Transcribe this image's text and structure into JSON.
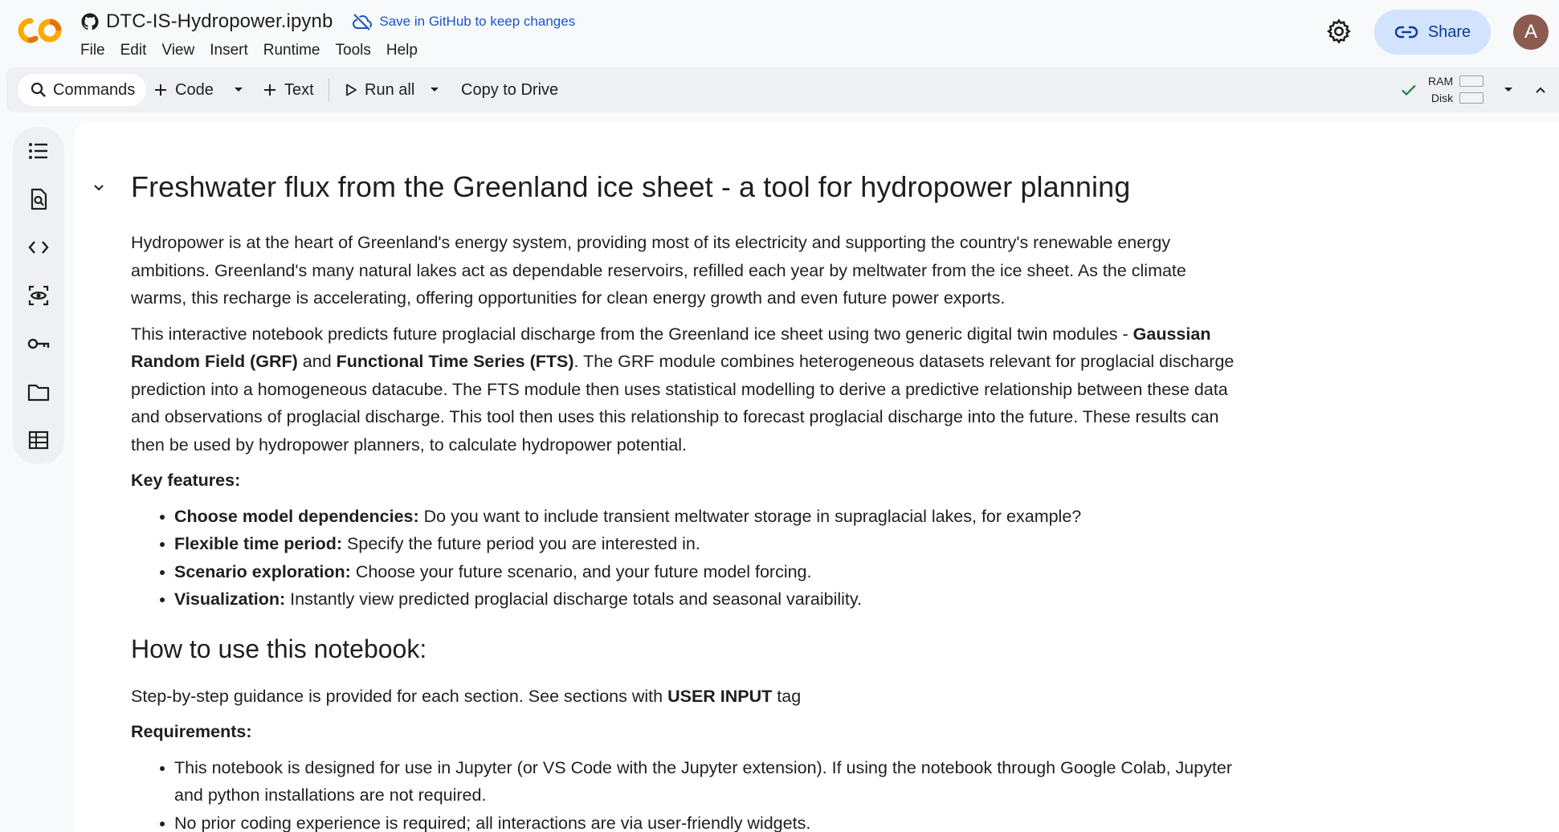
{
  "header": {
    "notebook_title": "DTC-IS-Hydropower.ipynb",
    "save_github_label": "Save in GitHub to keep changes",
    "menu": [
      "File",
      "Edit",
      "View",
      "Insert",
      "Runtime",
      "Tools",
      "Help"
    ],
    "share_label": "Share",
    "avatar_initial": "A"
  },
  "toolbar": {
    "commands_label": "Commands",
    "code_label": "Code",
    "text_label": "Text",
    "run_all_label": "Run all",
    "copy_to_drive_label": "Copy to Drive",
    "ram_label": "RAM",
    "disk_label": "Disk"
  },
  "colors": {
    "accent_blue": "#1a56c9",
    "share_bg": "#d3e3fd",
    "connected_green": "#188038",
    "logo_orange": "#f9ab00",
    "logo_dark_orange": "#e37400"
  },
  "sidebar_icons": [
    "table-of-contents-icon",
    "find-replace-icon",
    "code-snippets-icon",
    "variables-icon",
    "secrets-key-icon",
    "files-folder-icon",
    "data-table-icon"
  ],
  "notebook": {
    "title": "Freshwater flux from the Greenland ice sheet - a tool for hydropower planning",
    "intro": "Hydropower is at the heart of Greenland's energy system, providing most of its electricity and supporting the country's renewable energy ambitions. Greenland's many natural lakes act as dependable reservoirs, refilled each year by meltwater from the ice sheet. As the climate warms, this recharge is accelerating, offering opportunities for clean energy growth and even future power exports.",
    "p2_a": "This interactive notebook predicts future proglacial discharge from the Greenland ice sheet using two generic digital twin modules - ",
    "p2_grf": "Gaussian Random Field (GRF)",
    "p2_and": " and ",
    "p2_fts": "Functional Time Series (FTS)",
    "p2_b": ". The GRF module combines heterogeneous datasets relevant for proglacial discharge prediction into a homogeneous datacube. The FTS module then uses statistical modelling to derive a predictive relationship between these data and observations of proglacial discharge. This tool then uses this relationship to forecast proglacial discharge into the future. These results can then be used by hydropower planners, to calculate hydropower potential.",
    "key_features_heading": "Key features:",
    "features": [
      {
        "label": "Choose model dependencies:",
        "text": " Do you want to include transient meltwater storage in supraglacial lakes, for example?"
      },
      {
        "label": "Flexible time period:",
        "text": " Specify the future period you are interested in."
      },
      {
        "label": "Scenario exploration:",
        "text": " Choose your future scenario, and your future model forcing."
      },
      {
        "label": "Visualization:",
        "text": " Instantly view predicted proglacial discharge totals and seasonal varaibility."
      }
    ],
    "how_to_heading": "How to use this notebook:",
    "guidance_a": "Step-by-step guidance is provided for each section. See sections with ",
    "guidance_bold": "USER INPUT",
    "guidance_b": " tag",
    "requirements_heading": "Requirements:",
    "requirements": [
      "This notebook is designed for use in Jupyter (or VS Code with the Jupyter extension). If using the notebook through Google Colab, Jupyter and python installations are not required.",
      "No prior coding experience is required; all interactions are via user-friendly widgets."
    ]
  }
}
